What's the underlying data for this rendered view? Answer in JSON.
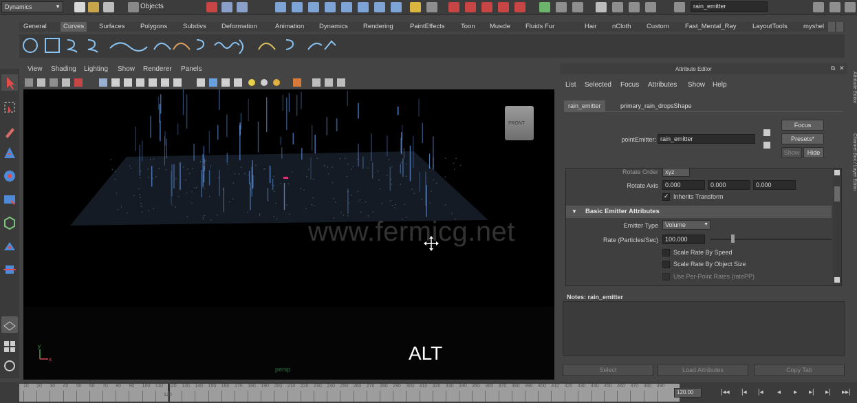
{
  "statusline": {
    "mode": "Dynamics",
    "selection_mask": "Objects",
    "name_field": "rain_emitter"
  },
  "shelf": {
    "tabs": [
      "General",
      "Curves",
      "Surfaces",
      "Polygons",
      "Subdivs",
      "Deformation",
      "Animation",
      "Dynamics",
      "Rendering",
      "PaintEffects",
      "Toon",
      "Muscle",
      "Fluids",
      "Fur",
      "Hair",
      "nCloth",
      "Custom",
      "Fast_Mental_Ray",
      "LayoutTools",
      "myshel"
    ],
    "active_tab": "Curves"
  },
  "panel": {
    "menus": [
      "View",
      "Shading",
      "Lighting",
      "Show",
      "Renderer",
      "Panels"
    ]
  },
  "viewport": {
    "watermark": "www.fermicg.net",
    "key_overlay": "ALT",
    "camera_label": "persp",
    "view_cube_label": "FRONT"
  },
  "attribute_editor": {
    "title": "Attribute Editor",
    "menus": [
      "List",
      "Selected",
      "Focus",
      "Attributes",
      "Show",
      "Help"
    ],
    "tabs": [
      "rain_emitter",
      "primary_rain_dropsShape"
    ],
    "node_type_label": "pointEmitter:",
    "node_name": "rain_emitter",
    "buttons": {
      "focus": "Focus",
      "presets": "Presets*",
      "show": "Show",
      "hide": "Hide"
    },
    "rotate_order": {
      "label": "Rotate Order",
      "value": "xyz"
    },
    "rotate_axis": {
      "label": "Rotate Axis",
      "values": [
        "0.000",
        "0.000",
        "0.000"
      ]
    },
    "inherits_transform": {
      "label": "Inherits Transform",
      "checked": true
    },
    "section": "Basic Emitter Attributes",
    "emitter_type": {
      "label": "Emitter Type",
      "value": "Volume"
    },
    "rate": {
      "label": "Rate (Particles/Sec)",
      "value": "100.000"
    },
    "scale_rate_by_speed": "Scale Rate By Speed",
    "scale_rate_by_object_size": "Scale Rate By Object Size",
    "use_per_point_rates": "Use Per-Point Rates (ratePP)",
    "notes_label": "Notes:  rain_emitter",
    "bottom_buttons": [
      "Select",
      "Load Attributes",
      "Copy Tab"
    ]
  },
  "side_tabs": [
    "Attribute Editor",
    "Channel Box / Layer Editor"
  ],
  "timeline": {
    "ticks": [
      "10",
      "20",
      "30",
      "40",
      "50",
      "60",
      "70",
      "80",
      "90",
      "100",
      "110",
      "120",
      "130",
      "140",
      "150",
      "160",
      "170",
      "180",
      "190",
      "200",
      "210",
      "220",
      "230",
      "240",
      "250",
      "260",
      "270",
      "280",
      "290",
      "300",
      "310",
      "320",
      "330",
      "340",
      "350",
      "360",
      "370",
      "380",
      "390",
      "400",
      "410",
      "420",
      "430",
      "440",
      "450",
      "460",
      "470",
      "480",
      "490"
    ],
    "current_frame": "120",
    "end_time": "120.00"
  },
  "colors": {
    "accent_pink": "#e0307a",
    "rain_blue": "#5b8fd8",
    "ground": "#1b2430"
  }
}
